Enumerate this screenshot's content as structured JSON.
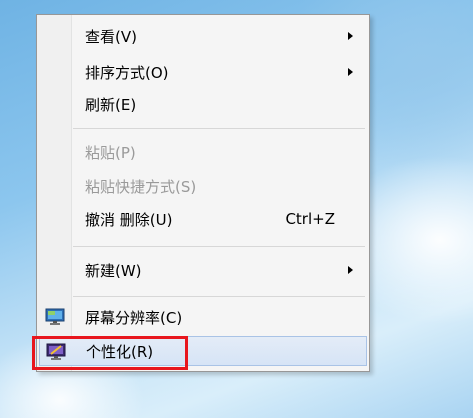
{
  "context_menu": {
    "items": [
      {
        "label": "查看(V)",
        "submenu": true
      },
      {
        "label": "排序方式(O)",
        "submenu": true
      },
      {
        "label": "刷新(E)"
      },
      {
        "label": "粘贴(P)",
        "disabled": true
      },
      {
        "label": "粘贴快捷方式(S)",
        "disabled": true
      },
      {
        "label": "撤消 删除(U)",
        "shortcut": "Ctrl+Z"
      },
      {
        "label": "新建(W)",
        "submenu": true
      },
      {
        "label": "屏幕分辨率(C)",
        "icon": "monitor-icon"
      },
      {
        "label": "个性化(R)",
        "icon": "personalize-icon",
        "highlighted": true
      }
    ]
  },
  "colors": {
    "highlight_border": "#e8161d",
    "hover_bg": "#d6e4f6"
  }
}
